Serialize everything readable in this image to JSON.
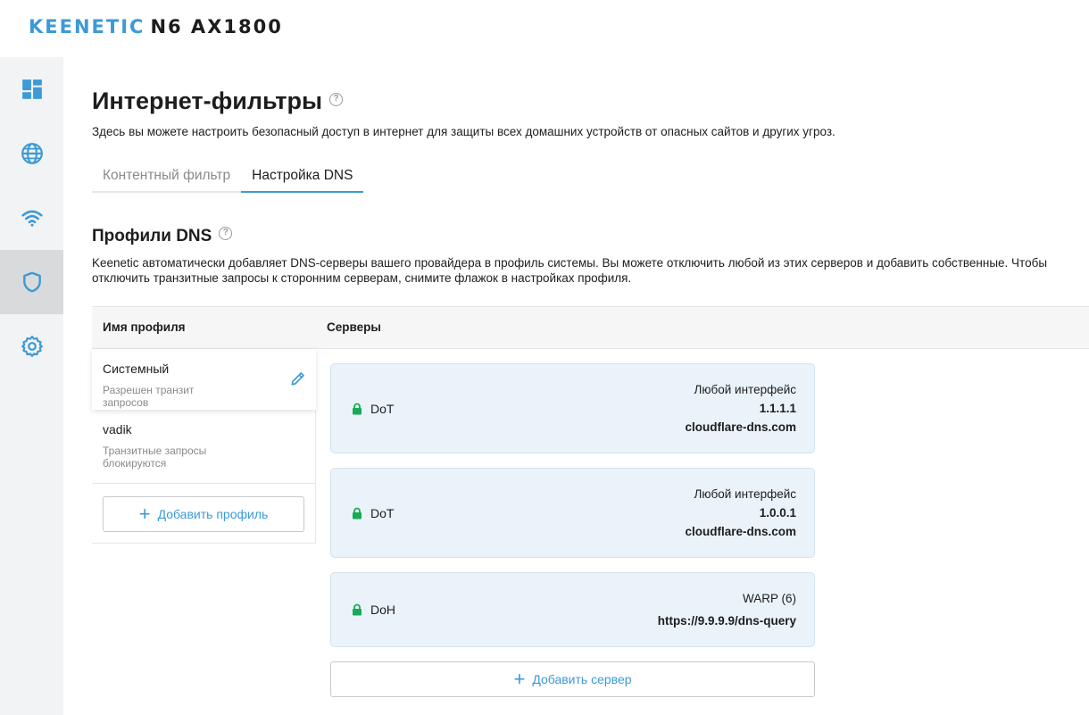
{
  "header": {
    "brand": "KEENETIC",
    "model": "N6 AX1800"
  },
  "sidebar": {
    "items": [
      {
        "icon": "dashboard-icon",
        "active": false
      },
      {
        "icon": "globe-icon",
        "active": false
      },
      {
        "icon": "wifi-icon",
        "active": false
      },
      {
        "icon": "shield-icon",
        "active": true
      },
      {
        "icon": "gear-icon",
        "active": false
      }
    ]
  },
  "page": {
    "title": "Интернет-фильтры",
    "description": "Здесь вы можете настроить безопасный доступ в интернет для защиты всех домашних устройств от опасных сайтов и других угроз."
  },
  "tabs": [
    {
      "label": "Контентный фильтр",
      "active": false
    },
    {
      "label": "Настройка DNS",
      "active": true
    }
  ],
  "dns_profiles": {
    "title": "Профили DNS",
    "description": "Keenetic автоматически добавляет DNS-серверы вашего провайдера в профиль системы. Вы можете отключить любой из этих серверов и добавить собственные. Чтобы отключить транзитные запросы к сторонним серверам, снимите флажок в настройках профиля.",
    "columns": {
      "name": "Имя профиля",
      "servers": "Серверы"
    },
    "profiles": [
      {
        "name": "Системный",
        "subtitle": "Разрешен транзит запросов",
        "selected": true
      },
      {
        "name": "vadik",
        "subtitle": "Транзитные запросы блокируются",
        "selected": false
      }
    ],
    "add_profile_label": "Добавить профиль",
    "servers": [
      {
        "protocol": "DoT",
        "interface": "Любой интерфейс",
        "address": "1.1.1.1",
        "hostname": "cloudflare-dns.com"
      },
      {
        "protocol": "DoT",
        "interface": "Любой интерфейс",
        "address": "1.0.0.1",
        "hostname": "cloudflare-dns.com"
      },
      {
        "protocol": "DoH",
        "interface": "WARP (6)",
        "address": "https://9.9.9.9/dns-query"
      }
    ],
    "add_server_label": "Добавить сервер"
  },
  "colors": {
    "accent": "#3c9ad6",
    "lock": "#1aaa55",
    "card_bg": "#eaf3fa",
    "sidebar_bg": "#f2f3f4"
  }
}
